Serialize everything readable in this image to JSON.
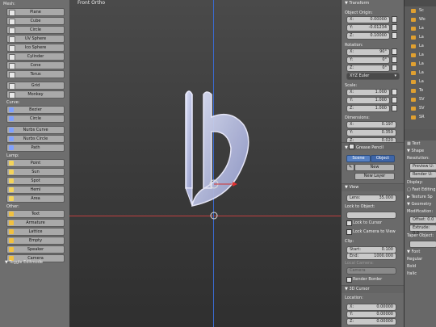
{
  "toolshelf": {
    "header": "Mesh:",
    "mesh_items": [
      "Plane",
      "Cube",
      "Circle",
      "UV Sphere",
      "Ico Sphere",
      "Cylinder",
      "Cone",
      "Torus"
    ],
    "mesh_extra": [
      "Grid",
      "Monkey"
    ],
    "curve_header": "Curve:",
    "curve_items": [
      "Bezier",
      "Circle"
    ],
    "nurbs_items": [
      "Nurbs Curve",
      "Nurbs Circle",
      "Path"
    ],
    "lamp_header": "Lamp:",
    "lamp_items": [
      "Point",
      "Sun",
      "Spot",
      "Hemi",
      "Area"
    ],
    "other_header": "Other:",
    "other_items": [
      "Text",
      "Armature",
      "Lattice",
      "Empty",
      "Speaker",
      "Camera"
    ],
    "toggle_editmode": "▼ Toggle Editmode"
  },
  "viewport": {
    "title": "Front Ortho"
  },
  "properties": {
    "transform_header": "▼ Transform",
    "location_label": "Object Origin:",
    "loc_x_key": "X:",
    "loc_x": "0.00000",
    "loc_y_key": "Y:",
    "loc_y": "-0.01234",
    "loc_z_key": "Z:",
    "loc_z": "0.10000",
    "rotation_label": "Rotation:",
    "rot_x_key": "X:",
    "rot_x": "90°",
    "rot_y_key": "Y:",
    "rot_y": "0°",
    "rot_z_key": "Z:",
    "rot_z": "0°",
    "rotation_mode": "XYZ Euler",
    "scale_label": "Scale:",
    "scale_x_key": "X:",
    "scale_x": "1.000",
    "scale_y_key": "Y:",
    "scale_y": "1.000",
    "scale_z_key": "Z:",
    "scale_z": "1.000",
    "dimensions_label": "Dimensions:",
    "dim_x_key": "X:",
    "dim_x": "0.197",
    "dim_y_key": "Y:",
    "dim_y": "0.359",
    "dim_z_key": "Z:",
    "dim_z": "0.020",
    "grease_header": "Grease Pencil",
    "scene_btn": "Scene",
    "object_btn": "Object",
    "new_btn": "New",
    "new_layer_btn": "New Layer",
    "view_header": "View",
    "lens_key": "Lens:",
    "lens": "35.000",
    "lock_object_label": "Lock to Object:",
    "lock_cursor": "Lock to Cursor",
    "lock_camera": "Lock Camera to View",
    "clip_label": "Clip:",
    "clip_start_key": "Start:",
    "clip_start": "0.100",
    "clip_end_key": "End:",
    "clip_end": "1000.000",
    "local_camera_label": "Local Camera:",
    "local_camera_value": "Camera",
    "render_border": "Render Border",
    "cursor3d_header": "3D Cursor",
    "cursor_location_label": "Location:",
    "cur_x_key": "X:",
    "cur_x": "0.00000",
    "cur_y_key": "Y:",
    "cur_y": "0.00000",
    "cur_z_key": "Z:",
    "cur_z": "0.00000"
  },
  "outliner": {
    "items": [
      "Sc",
      "Wo",
      "La",
      "La",
      "La",
      "La",
      "La",
      "La",
      "La",
      "Te",
      "SV",
      "SV",
      "SR"
    ]
  },
  "props2": {
    "text_tab": "Text",
    "shape_header": "Shape",
    "resolution_label": "Resolution:",
    "preview_field": "Preview U:",
    "render_field": "Render U:",
    "display_label": "Display:",
    "fast_editing": "Fast Editing",
    "texture_space": "Texture Sp",
    "geometry_header": "Geometry",
    "modification_label": "Modification:",
    "offset_field": "Offset: 0.0",
    "extrude_field": "Extrude: 0.0",
    "taper_label": "Taper Object:",
    "font_header": "Font",
    "regular": "Regular",
    "bold": "Bold",
    "italic": "Italic"
  },
  "colors": {
    "accent": "#5680c2",
    "x_axis": "#c04040",
    "z_axis": "#3a6ad0"
  }
}
